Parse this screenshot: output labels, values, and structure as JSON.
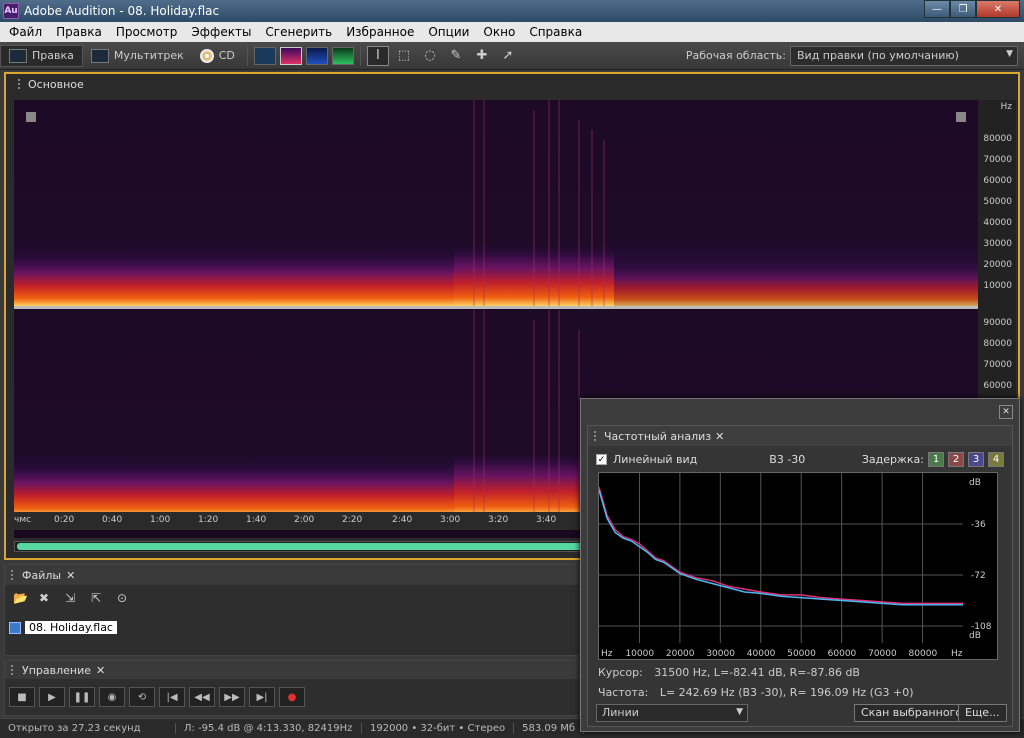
{
  "window": {
    "app_icon": "Au",
    "title": "Adobe Audition - 08. Holiday.flac",
    "minimize": "—",
    "maximize": "❐",
    "close": "✕"
  },
  "menu": [
    "Файл",
    "Правка",
    "Просмотр",
    "Эффекты",
    "Сгенерить",
    "Избранное",
    "Опции",
    "Окно",
    "Справка"
  ],
  "toolbar": {
    "edit_label": "Правка",
    "multitrack_label": "Мультитрек",
    "cd_label": "CD",
    "workspace_label": "Рабочая область:",
    "workspace_value": "Вид правки (по умолчанию)"
  },
  "main_panel": {
    "tab_label": "Основное"
  },
  "hz_axis": {
    "unit": "Hz",
    "ch1": [
      "80000",
      "70000",
      "60000",
      "50000",
      "40000",
      "30000",
      "20000",
      "10000"
    ],
    "ch2": [
      "90000",
      "80000",
      "70000",
      "60000"
    ]
  },
  "time_axis": [
    "чмс",
    "0:20",
    "0:40",
    "1:00",
    "1:20",
    "1:40",
    "2:00",
    "2:20",
    "2:40",
    "3:00",
    "3:20",
    "3:40"
  ],
  "files_panel": {
    "tab_label": "Файлы",
    "file_name": "08. Holiday.flac"
  },
  "control_panel": {
    "tab_label": "Управление"
  },
  "status": {
    "opened": "Открыто за 27.23 секунд",
    "level": "Л: -95.4 dB @  4:13.330, 82419Hz",
    "format": "192000 • 32-бит • Стерео",
    "size": "583.09 Мб"
  },
  "freq_analysis": {
    "tab_label": "Частотный анализ",
    "linear_view_label": "Линейный вид",
    "note": "B3 -30",
    "delay_label": "Задержка:",
    "delays": [
      "1",
      "2",
      "3",
      "4"
    ],
    "y_unit": "dB",
    "y_ticks": [
      "-36",
      "-72",
      "-108"
    ],
    "x_unit": "Hz",
    "x_ticks": [
      "10000",
      "20000",
      "30000",
      "40000",
      "50000",
      "60000",
      "70000",
      "80000"
    ],
    "cursor_label": "Курсор:",
    "cursor_value": "31500 Hz, L=-82.41 dB, R=-87.86 dB",
    "freq_label": "Частота:",
    "freq_value": "L= 242.69 Hz (B3 -30), R= 196.09 Hz (G3 +0)",
    "mode_value": "Линии",
    "scan_button": "Скан выбранного",
    "more_button": "Еще...",
    "colors": {
      "left": "#e0307a",
      "right": "#4ab8f0"
    }
  },
  "chart_data": {
    "type": "line",
    "x": [
      0,
      2000,
      4000,
      6000,
      8000,
      10000,
      12000,
      14000,
      16000,
      18000,
      20000,
      24000,
      28000,
      32000,
      36000,
      40000,
      45000,
      50000,
      55000,
      60000,
      65000,
      70000,
      75000,
      80000,
      85000,
      90000
    ],
    "series": [
      {
        "values": [
          -10,
          -30,
          -40,
          -45,
          -47,
          -50,
          -55,
          -60,
          -62,
          -66,
          -70,
          -74,
          -76,
          -80,
          -82,
          -84,
          -86,
          -86,
          -88,
          -89,
          -90,
          -91,
          -92,
          -92,
          -92,
          -92
        ]
      },
      {
        "values": [
          -12,
          -32,
          -42,
          -46,
          -48,
          -52,
          -56,
          -61,
          -63,
          -67,
          -71,
          -75,
          -78,
          -81,
          -84,
          -85,
          -87,
          -88,
          -89,
          -90,
          -91,
          -92,
          -93,
          -93,
          -93,
          -93
        ]
      }
    ],
    "ylim": [
      -120,
      0
    ]
  }
}
